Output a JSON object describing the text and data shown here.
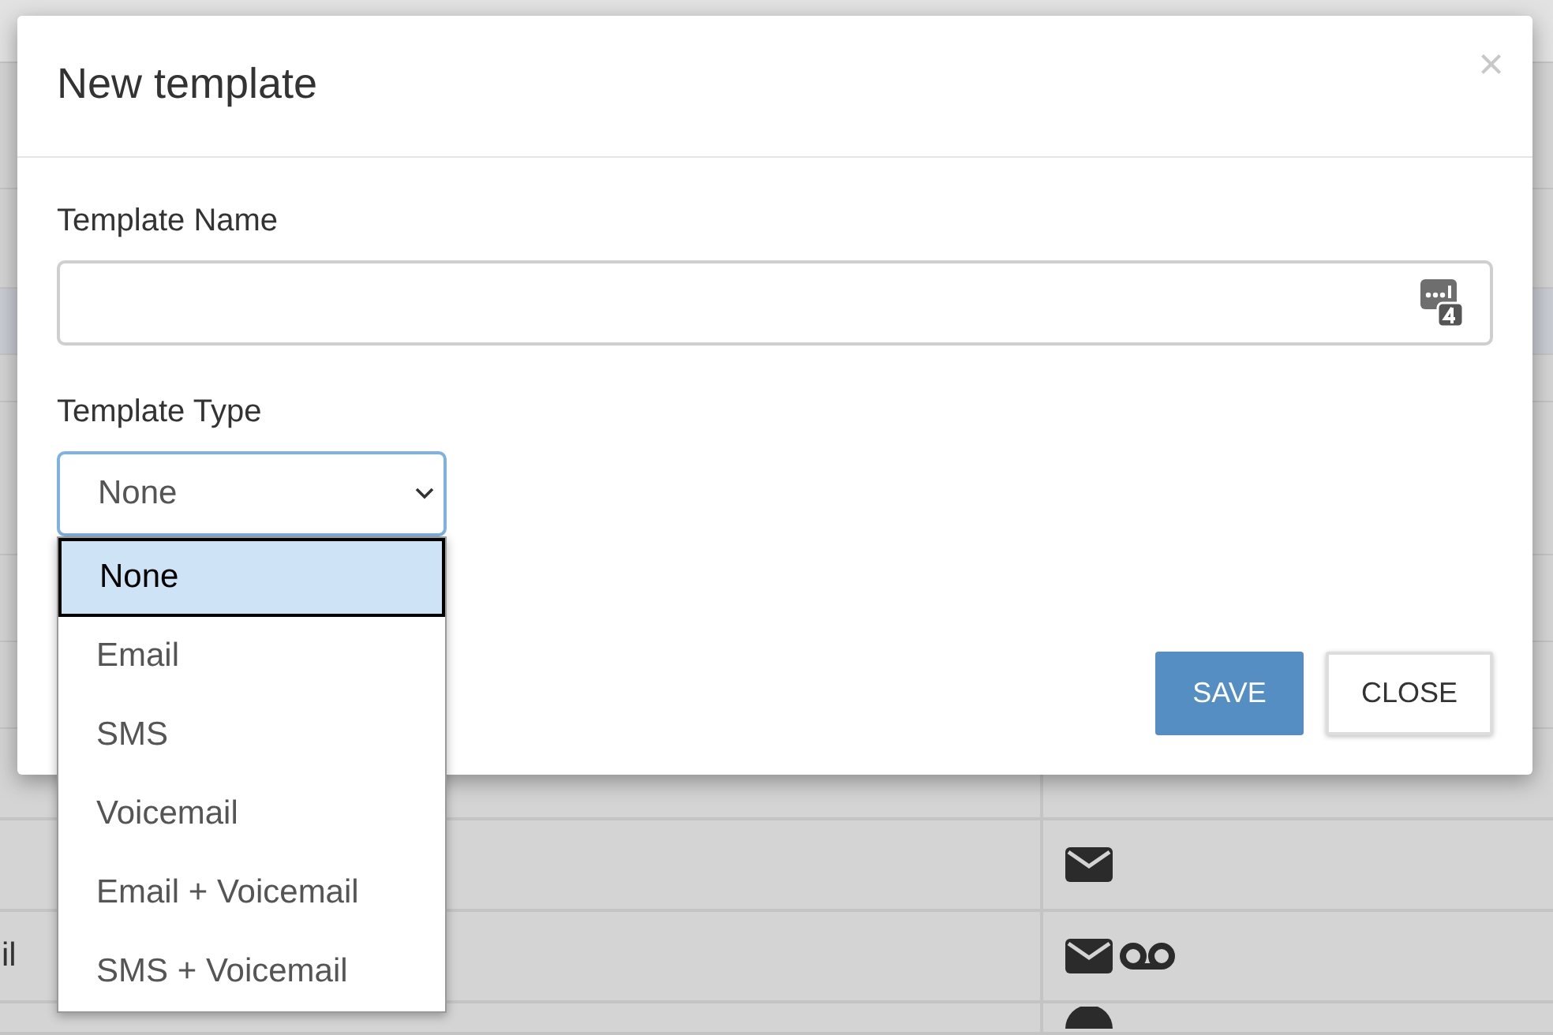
{
  "background": {
    "rows": [
      {
        "kind": "email"
      },
      {
        "kind": "email_voicemail",
        "cell_fragment": "il"
      },
      {
        "kind": "dot"
      }
    ]
  },
  "dialog": {
    "title": "New template",
    "close_symbol": "×",
    "name_field": {
      "label": "Template Name"
    },
    "type_field": {
      "label": "Template Type",
      "value": "None",
      "expanded": true,
      "options": [
        {
          "label": "None",
          "selected": true
        },
        {
          "label": "Email",
          "selected": false
        },
        {
          "label": "SMS",
          "selected": false
        },
        {
          "label": "Voicemail",
          "selected": false
        },
        {
          "label": "Email + Voicemail",
          "selected": false
        },
        {
          "label": "SMS + Voicemail",
          "selected": false
        }
      ]
    },
    "buttons": [
      {
        "label": "SAVE",
        "kind": "primary"
      },
      {
        "label": "CLOSE",
        "kind": "default"
      }
    ]
  }
}
